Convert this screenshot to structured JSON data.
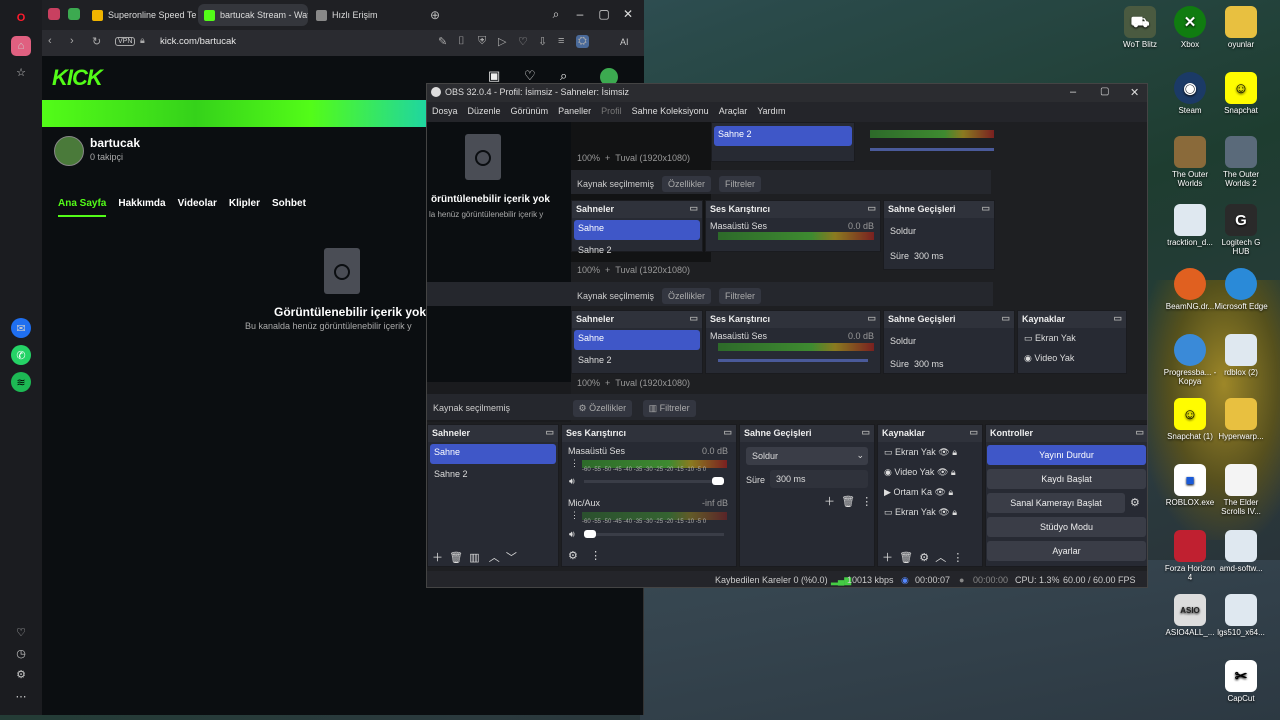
{
  "browser": {
    "tabs": [
      {
        "label": "Superonline Speed Test |",
        "color": "#f0b400"
      },
      {
        "label": "bartucak Stream - Watch",
        "color": "#53fc18"
      },
      {
        "label": "Hızlı Erişim",
        "color": "#888888"
      }
    ],
    "address": "kick.com/bartucak",
    "vpn": "VPN",
    "ai": "AI"
  },
  "kick": {
    "logo": "KICK",
    "channel_name": "bartucak",
    "followers": "0 takipçi",
    "tabs": [
      "Ana Sayfa",
      "Hakkımda",
      "Videolar",
      "Klipler",
      "Sohbet"
    ],
    "empty_title": "Görüntülenebilir içerik yok",
    "empty_sub": "Bu kanalda henüz görüntülenebilir içerik y",
    "empty_title_cut": "örüntülenebilir içerik yok",
    "empty_sub_cut": "la henüz görüntülenebilir içerik y"
  },
  "obs": {
    "title": "OBS 32.0.4 - Profil: İsimsiz - Sahneler: İsimsiz",
    "menu": [
      "Dosya",
      "Düzenle",
      "Görünüm",
      "Paneller",
      "Profil",
      "Sahne Koleksiyonu",
      "Araçlar",
      "Yardım"
    ],
    "zoom": "100%",
    "canvas": "Tuval (1920x1080)",
    "no_source": "Kaynak seçilmemiş",
    "properties": "Özellikler",
    "filters": "Filtreler",
    "scenes_header": "Sahneler",
    "scenes": [
      "Sahne",
      "Sahne 2"
    ],
    "mixer_header": "Ses Karıştırıcı",
    "desktop_audio": "Masaüstü Ses",
    "desktop_db": "0.0 dB",
    "mic_aux": "Mic/Aux",
    "mic_db": "-inf dB",
    "meter_scale": "-60 -55 -50 -45 -40 -35 -30 -25 -20 -15 -10 -5 0",
    "transitions_header": "Sahne Geçişleri",
    "transition": "Soldur",
    "duration_label": "Süre",
    "duration": "300 ms",
    "sources_header": "Kaynaklar",
    "sources": [
      "Ekran Yak",
      "Video Yak",
      "Ortam Ka",
      "Ekran Yak"
    ],
    "controls_header": "Kontroller",
    "controls": [
      "Yayını Durdur",
      "Kaydı Başlat",
      "Sanal Kamerayı Başlat",
      "Stüdyo Modu",
      "Ayarlar"
    ],
    "status": {
      "dropped": "Kaybedilen Kareler 0 (%0.0)",
      "bitrate": "10013 kbps",
      "stream_time": "00:00:07",
      "rec_time": "00:00:00",
      "cpu": "CPU: 1.3%",
      "fps": "60.00 / 60.00 FPS"
    }
  },
  "desktop_icons": [
    {
      "label": "WoT Blitz"
    },
    {
      "label": "Xbox"
    },
    {
      "label": "oyunlar"
    },
    {
      "label": "Steam"
    },
    {
      "label": "Snapchat"
    },
    {
      "label": "The Outer Worlds"
    },
    {
      "label": "The Outer Worlds 2"
    },
    {
      "label": "tracktion_d..."
    },
    {
      "label": "Logitech G HUB"
    },
    {
      "label": "BeamNG.dr..."
    },
    {
      "label": "Microsoft Edge"
    },
    {
      "label": "Progressba... - Kopya"
    },
    {
      "label": "rdblox (2)"
    },
    {
      "label": "Snapchat (1)"
    },
    {
      "label": "Hyperwarp..."
    },
    {
      "label": "ROBLOX.exe"
    },
    {
      "label": "The Elder Scrolls IV..."
    },
    {
      "label": "Forza Horizon 4"
    },
    {
      "label": "amd-softw..."
    },
    {
      "label": "ASIO4ALL_..."
    },
    {
      "label": "lgs510_x64..."
    },
    {
      "label": "CapCut"
    }
  ]
}
